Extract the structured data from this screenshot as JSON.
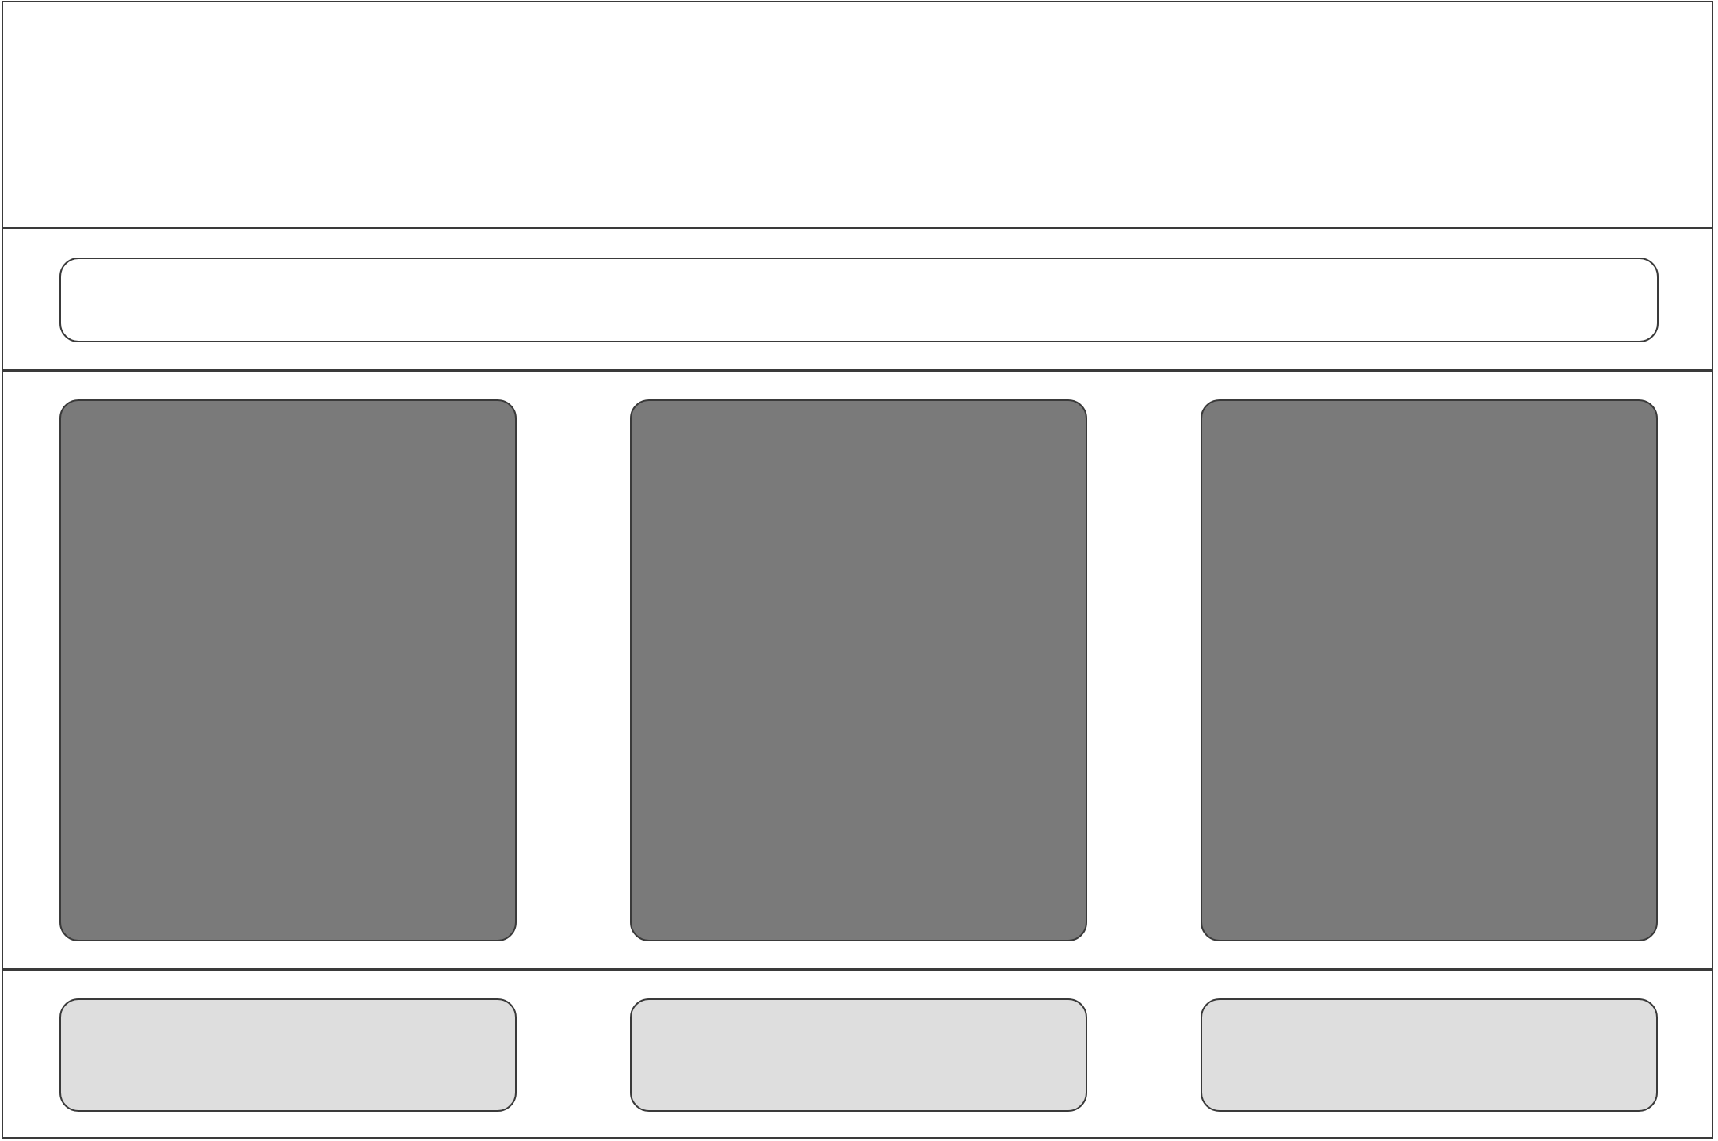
{
  "colors": {
    "border": "#3a3a3a",
    "background": "#ffffff",
    "card_fill": "#7a7a7a",
    "tile_fill": "#dedede"
  },
  "header": {},
  "search_bar": {},
  "content_cards": [
    {},
    {},
    {}
  ],
  "footer_tiles": [
    {},
    {},
    {}
  ]
}
